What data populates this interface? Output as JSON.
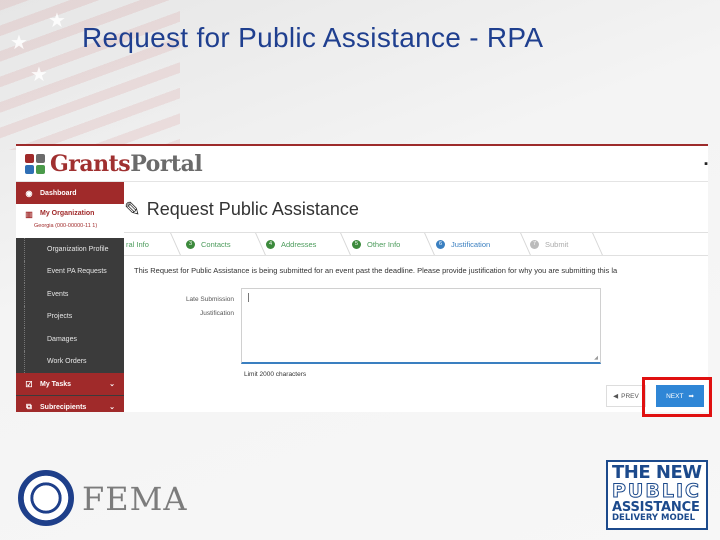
{
  "slide": {
    "title": "Request for Public Assistance - RPA"
  },
  "app": {
    "logo_part1": "Grants",
    "logo_part2": "Portal",
    "topbar_menu_icon": "menu-icon"
  },
  "sidebar": {
    "dashboard": "Dashboard",
    "my_organization": "My Organization",
    "organization_sub": "Georgia (000-00000-11 1)",
    "sub_items": [
      "Organization Profile",
      "Event PA Requests",
      "Events",
      "Projects",
      "Damages",
      "Work Orders"
    ],
    "my_tasks": "My Tasks",
    "subrecipients": "Subrecipients"
  },
  "page": {
    "heading": "Request Public Assistance"
  },
  "stepper": {
    "steps": [
      {
        "num": "",
        "label": "ral Info",
        "state": "done"
      },
      {
        "num": "3",
        "label": "Contacts",
        "state": "done"
      },
      {
        "num": "4",
        "label": "Addresses",
        "state": "done"
      },
      {
        "num": "5",
        "label": "Other Info",
        "state": "done"
      },
      {
        "num": "6",
        "label": "Justification",
        "state": "active"
      },
      {
        "num": "7",
        "label": "Submit",
        "state": "disabled"
      }
    ]
  },
  "form": {
    "notice": "This Request for Public Assistance is being submitted for an event past the deadline. Please provide justification for why you are submitting this la",
    "field_label_1": "Late Submission",
    "field_label_2": "Justification",
    "textarea_value": "",
    "limit_text": "Limit 2000 characters"
  },
  "buttons": {
    "prev_label": "PREV",
    "next_label": "NEXT"
  },
  "footer": {
    "fema_text": "FEMA",
    "pa_line1": "THE NEW",
    "pa_line2": "PUBLIC",
    "pa_line3": "ASSISTANCE",
    "pa_line4": "DELIVERY MODEL"
  },
  "colors": {
    "title_blue": "#1f3f8f",
    "sidebar_dark": "#3b3b3b",
    "sidebar_red": "#a02a2a",
    "step_green": "#3c8a3c",
    "step_active": "#3a7fc0",
    "next_button": "#2f86d6",
    "highlight_red": "#e01010"
  }
}
